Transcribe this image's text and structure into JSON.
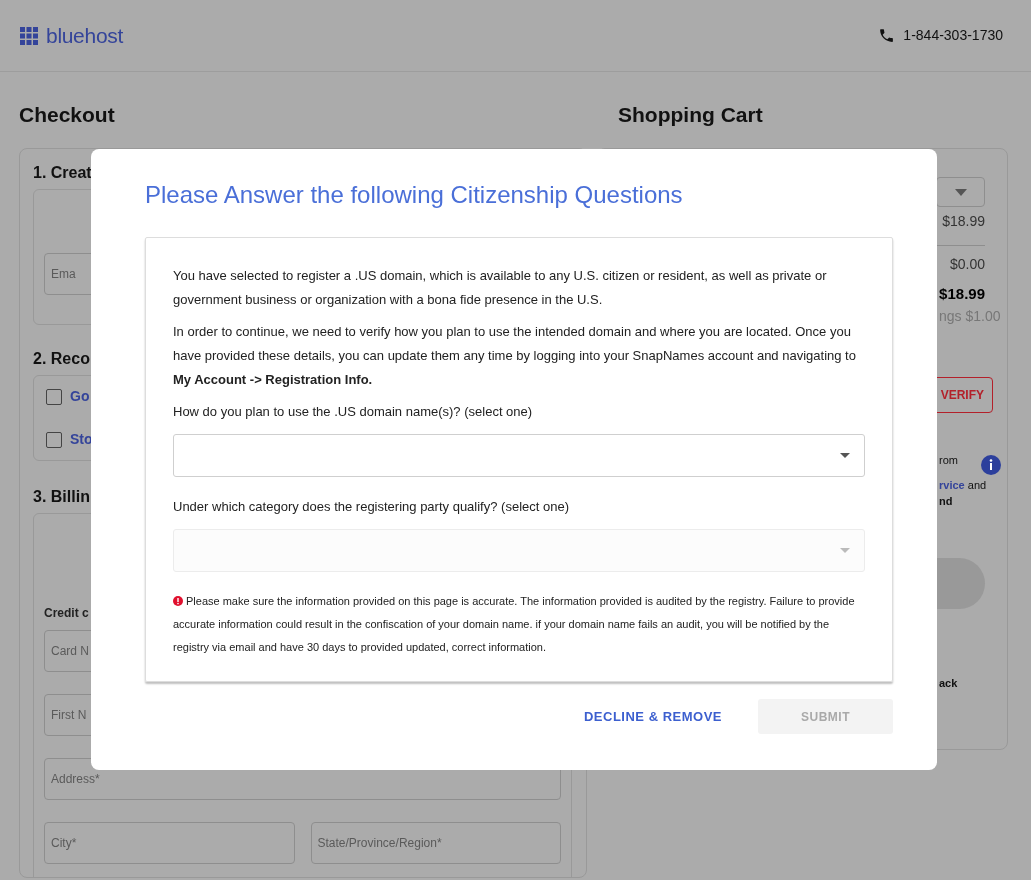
{
  "header": {
    "logo": "bluehost",
    "phone": "1-844-303-1730"
  },
  "checkout": {
    "title": "Checkout",
    "account": {
      "heading": "1. Creat",
      "email_placeholder": "Ema"
    },
    "recommended": {
      "heading": "2. Reco",
      "options": [
        {
          "label": "Go",
          "checked": false
        },
        {
          "label": "Sto",
          "checked": false
        }
      ]
    },
    "billing": {
      "heading": "3. Billin",
      "subheading": "Credit c",
      "rows": [
        [
          {
            "placeholder": "Card N"
          }
        ],
        [
          {
            "placeholder": "First N"
          }
        ],
        [
          {
            "placeholder": "Address*"
          }
        ],
        [
          {
            "placeholder": "City*"
          },
          {
            "placeholder": "State/Province/Region*"
          }
        ]
      ]
    }
  },
  "cart": {
    "title": "Shopping Cart",
    "price": "$18.99",
    "discount": "$0.00",
    "total": "$18.99",
    "savings": "ngs $1.00",
    "verify_button": "VERIFY",
    "notice": "rom",
    "terms_link": "rvice",
    "terms_rest": "and",
    "terms_bold": "nd",
    "footer_note": "ack"
  },
  "modal": {
    "title": "Please Answer the following Citizenship Questions",
    "paragraphs": [
      "You have selected to register a .US domain, which is available to any U.S. citizen or resident, as well as private or government business or organization with a bona fide presence in the U.S.",
      "In order to continue, we need to verify how you plan to use the intended domain and where you are located. Once you have provided these details, you can update them any time by logging into your SnapNames account and navigating to **My Account -> Registration Info.**"
    ],
    "questions": [
      {
        "label": "How do you plan to use the .US domain name(s)? (select one)",
        "disabled": false
      },
      {
        "label": "Under which category does the registering party qualify? (select one)",
        "disabled": true
      }
    ],
    "warning": "Please make sure the information provided on this page is accurate. The information provided is audited by the registry. Failure to provide accurate information could result in the confiscation of your domain name. if your domain name fails an audit, you will be notified by the registry via email and have 30 days to provided updated, correct information.",
    "buttons": [
      {
        "label": "DECLINE & REMOVE",
        "kind": "link",
        "disabled": false
      },
      {
        "label": "SUBMIT",
        "kind": "solid",
        "disabled": true
      }
    ]
  }
}
